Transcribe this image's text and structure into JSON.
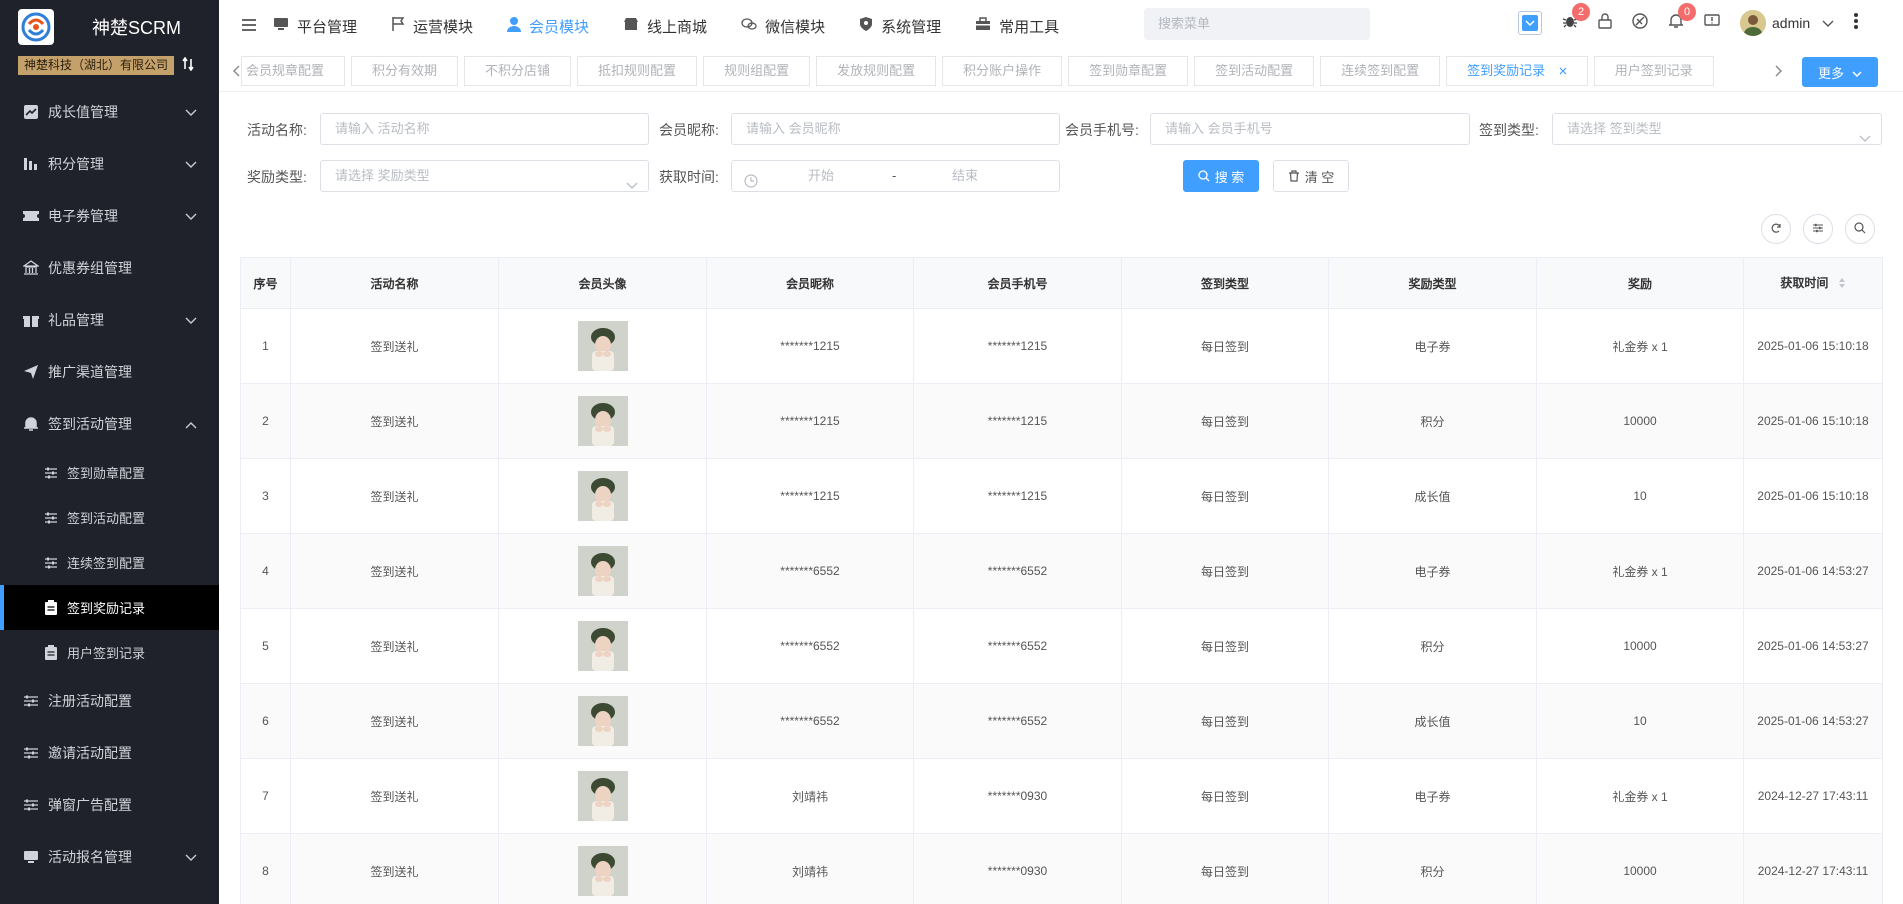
{
  "brand": {
    "title": "神楚SCRM",
    "org": "神楚科技（湖北）有限公司"
  },
  "sidebar": {
    "items": [
      {
        "label": "成长值管理",
        "icon": "trend-icon",
        "expandable": true
      },
      {
        "label": "积分管理",
        "icon": "bar-icon",
        "expandable": true
      },
      {
        "label": "电子券管理",
        "icon": "ticket-icon",
        "expandable": true
      },
      {
        "label": "优惠券组管理",
        "icon": "bank-icon",
        "expandable": false
      },
      {
        "label": "礼品管理",
        "icon": "gift-icon",
        "expandable": true
      },
      {
        "label": "推广渠道管理",
        "icon": "send-icon",
        "expandable": false
      },
      {
        "label": "签到活动管理",
        "icon": "bell-icon",
        "expandable": true,
        "expanded": true
      }
    ],
    "sub_items": [
      {
        "label": "签到勋章配置",
        "active": false
      },
      {
        "label": "签到活动配置",
        "active": false
      },
      {
        "label": "连续签到配置",
        "active": false
      },
      {
        "label": "签到奖励记录",
        "active": true
      },
      {
        "label": "用户签到记录",
        "active": false
      }
    ],
    "bottom_items": [
      {
        "label": "注册活动配置",
        "expandable": false
      },
      {
        "label": "邀请活动配置",
        "expandable": false
      },
      {
        "label": "弹窗广告配置",
        "expandable": false
      },
      {
        "label": "活动报名管理",
        "expandable": true
      }
    ]
  },
  "header": {
    "nav": [
      {
        "label": "平台管理",
        "icon": "monitor-icon",
        "active": false
      },
      {
        "label": "运营模块",
        "icon": "flag-icon",
        "active": false
      },
      {
        "label": "会员模块",
        "icon": "user-icon",
        "active": true
      },
      {
        "label": "线上商城",
        "icon": "shop-icon",
        "active": false
      },
      {
        "label": "微信模块",
        "icon": "wechat-icon",
        "active": false
      },
      {
        "label": "系统管理",
        "icon": "shield-icon",
        "active": false
      },
      {
        "label": "常用工具",
        "icon": "toolbox-icon",
        "active": false
      }
    ],
    "search_placeholder": "搜索菜单",
    "bug_count": "2",
    "notify_count": "0",
    "username": "admin"
  },
  "tags": {
    "items": [
      {
        "label": "会员规章配置",
        "active": false
      },
      {
        "label": "积分有效期",
        "active": false
      },
      {
        "label": "不积分店铺",
        "active": false
      },
      {
        "label": "抵扣规则配置",
        "active": false
      },
      {
        "label": "规则组配置",
        "active": false
      },
      {
        "label": "发放规则配置",
        "active": false
      },
      {
        "label": "积分账户操作",
        "active": false
      },
      {
        "label": "签到勋章配置",
        "active": false
      },
      {
        "label": "签到活动配置",
        "active": false
      },
      {
        "label": "连续签到配置",
        "active": false
      },
      {
        "label": "签到奖励记录",
        "active": true
      },
      {
        "label": "用户签到记录",
        "active": false
      }
    ],
    "more_label": "更多"
  },
  "filters": {
    "activity_name": {
      "label": "活动名称:",
      "placeholder": "请输入 活动名称"
    },
    "member_nickname": {
      "label": "会员昵称:",
      "placeholder": "请输入 会员昵称"
    },
    "member_phone": {
      "label": "会员手机号:",
      "placeholder": "请输入 会员手机号"
    },
    "sign_type": {
      "label": "签到类型:",
      "placeholder": "请选择 签到类型"
    },
    "reward_type": {
      "label": "奖励类型:",
      "placeholder": "请选择 奖励类型"
    },
    "obtain_time": {
      "label": "获取时间:",
      "start": "开始",
      "sep": "-",
      "end": "结束"
    },
    "search_label": "搜 索",
    "clear_label": "清 空"
  },
  "table": {
    "columns": [
      "序号",
      "活动名称",
      "会员头像",
      "会员昵称",
      "会员手机号",
      "签到类型",
      "奖励类型",
      "奖励",
      "获取时间"
    ],
    "rows": [
      {
        "no": "1",
        "activity": "签到送礼",
        "nickname": "*******1215",
        "phone": "*******1215",
        "sign_type": "每日签到",
        "reward_type": "电子券",
        "reward": "礼金券 x 1",
        "time": "2025-01-06 15:10:18"
      },
      {
        "no": "2",
        "activity": "签到送礼",
        "nickname": "*******1215",
        "phone": "*******1215",
        "sign_type": "每日签到",
        "reward_type": "积分",
        "reward": "10000",
        "time": "2025-01-06 15:10:18"
      },
      {
        "no": "3",
        "activity": "签到送礼",
        "nickname": "*******1215",
        "phone": "*******1215",
        "sign_type": "每日签到",
        "reward_type": "成长值",
        "reward": "10",
        "time": "2025-01-06 15:10:18"
      },
      {
        "no": "4",
        "activity": "签到送礼",
        "nickname": "*******6552",
        "phone": "*******6552",
        "sign_type": "每日签到",
        "reward_type": "电子券",
        "reward": "礼金券 x 1",
        "time": "2025-01-06 14:53:27"
      },
      {
        "no": "5",
        "activity": "签到送礼",
        "nickname": "*******6552",
        "phone": "*******6552",
        "sign_type": "每日签到",
        "reward_type": "积分",
        "reward": "10000",
        "time": "2025-01-06 14:53:27"
      },
      {
        "no": "6",
        "activity": "签到送礼",
        "nickname": "*******6552",
        "phone": "*******6552",
        "sign_type": "每日签到",
        "reward_type": "成长值",
        "reward": "10",
        "time": "2025-01-06 14:53:27"
      },
      {
        "no": "7",
        "activity": "签到送礼",
        "nickname": "刘靖祎",
        "phone": "*******0930",
        "sign_type": "每日签到",
        "reward_type": "电子券",
        "reward": "礼金券 x 1",
        "time": "2024-12-27 17:43:11"
      },
      {
        "no": "8",
        "activity": "签到送礼",
        "nickname": "刘靖祎",
        "phone": "*******0930",
        "sign_type": "每日签到",
        "reward_type": "积分",
        "reward": "10000",
        "time": "2024-12-27 17:43:11"
      }
    ]
  },
  "colors": {
    "accent": "#409eff",
    "sidebar_bg": "#1f222a",
    "badge": "#f56c6c",
    "org_badge": "#c4a06a"
  }
}
